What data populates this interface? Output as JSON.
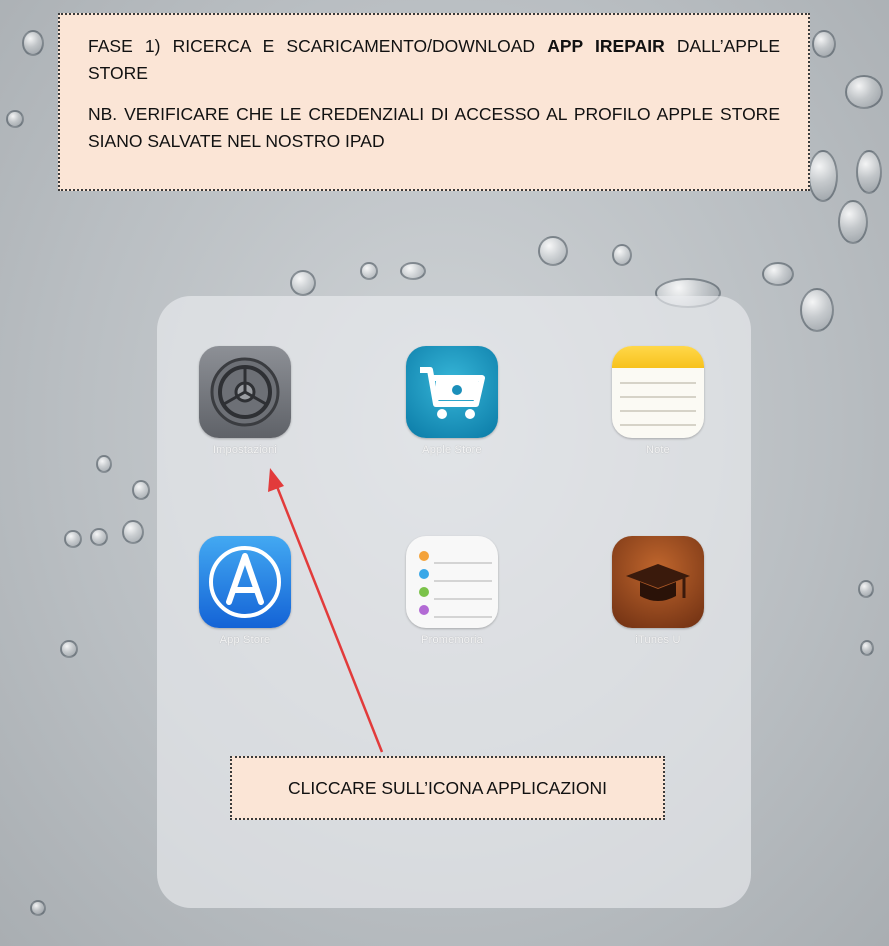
{
  "callout_top": {
    "line1_prefix": "FASE 1) RICERCA E SCARICAMENTO/DOWNLOAD ",
    "line1_bold": "APP IREPAIR",
    "line1_suffix": " DALL’APPLE STORE",
    "note": "NB. VERIFICARE CHE LE CREDENZIALI DI ACCESSO AL PROFILO APPLE STORE SIANO SALVATE NEL NOSTRO IPAD"
  },
  "callout_bottom": {
    "text": "CLICCARE SULL’ICONA APPLICAZIONI"
  },
  "folder": {
    "apps": [
      {
        "label": "Impostazioni",
        "icon": "settings-gear-icon"
      },
      {
        "label": "Apple Store",
        "icon": "apple-store-cart-icon"
      },
      {
        "label": "Note",
        "icon": "notes-icon"
      },
      {
        "label": "App Store",
        "icon": "app-store-icon"
      },
      {
        "label": "Promemoria",
        "icon": "reminders-icon"
      },
      {
        "label": "iTunes U",
        "icon": "itunes-u-icon"
      }
    ]
  },
  "colors": {
    "callout_background": "#fbe5d6",
    "arrow": "#e23b3b"
  }
}
